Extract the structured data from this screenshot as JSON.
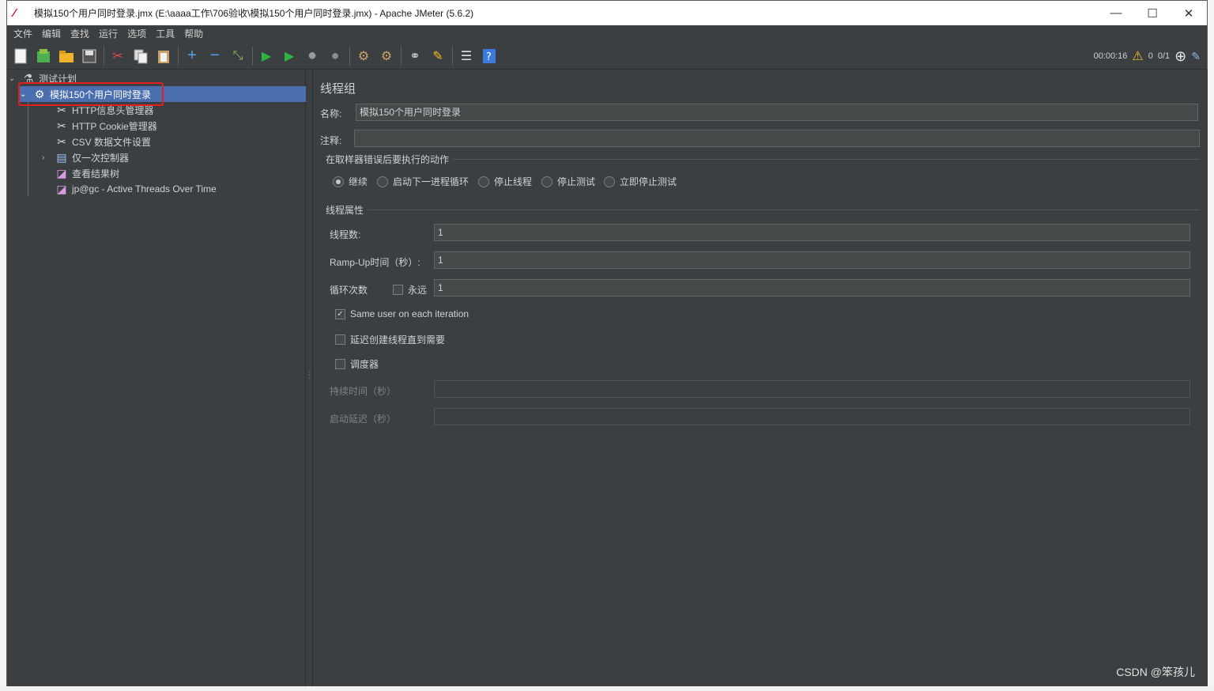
{
  "window": {
    "title": "模拟150个用户同时登录.jmx (E:\\aaaa工作\\706验收\\模拟150个用户同时登录.jmx) - Apache JMeter (5.6.2)",
    "minimize": "—",
    "maximize": "☐",
    "close": "✕"
  },
  "menu": [
    "文件",
    "编辑",
    "查找",
    "运行",
    "选项",
    "工具",
    "帮助"
  ],
  "toolbar": {
    "timer": "00:00:16",
    "warnings": "0",
    "threads": "0/1"
  },
  "tree": {
    "root": "测试计划",
    "thread_group": "模拟150个用户同时登录",
    "children": [
      "HTTP信息头管理器",
      "HTTP Cookie管理器",
      "CSV 数据文件设置",
      "仅一次控制器",
      "查看结果树",
      "jp@gc - Active Threads Over Time"
    ]
  },
  "panel": {
    "heading": "线程组",
    "name_label": "名称:",
    "name_value": "模拟150个用户同时登录",
    "comment_label": "注释:",
    "comment_value": "",
    "error_action_title": "在取样器错误后要执行的动作",
    "error_actions": [
      "继续",
      "启动下一进程循环",
      "停止线程",
      "停止测试",
      "立即停止测试"
    ],
    "selected_action": "继续",
    "thread_props_title": "线程属性",
    "threads_label": "线程数:",
    "threads_value": "1",
    "rampup_label": "Ramp-Up时间（秒）:",
    "rampup_value": "1",
    "loop_label": "循环次数",
    "forever_label": "永远",
    "loop_value": "1",
    "same_user_label": "Same user on each iteration",
    "same_user_checked": true,
    "delay_label": "延迟创建线程直到需要",
    "scheduler_label": "调度器",
    "duration_label": "持续时间（秒）",
    "startup_delay_label": "启动延迟（秒）"
  },
  "watermark": "CSDN @笨孩儿"
}
